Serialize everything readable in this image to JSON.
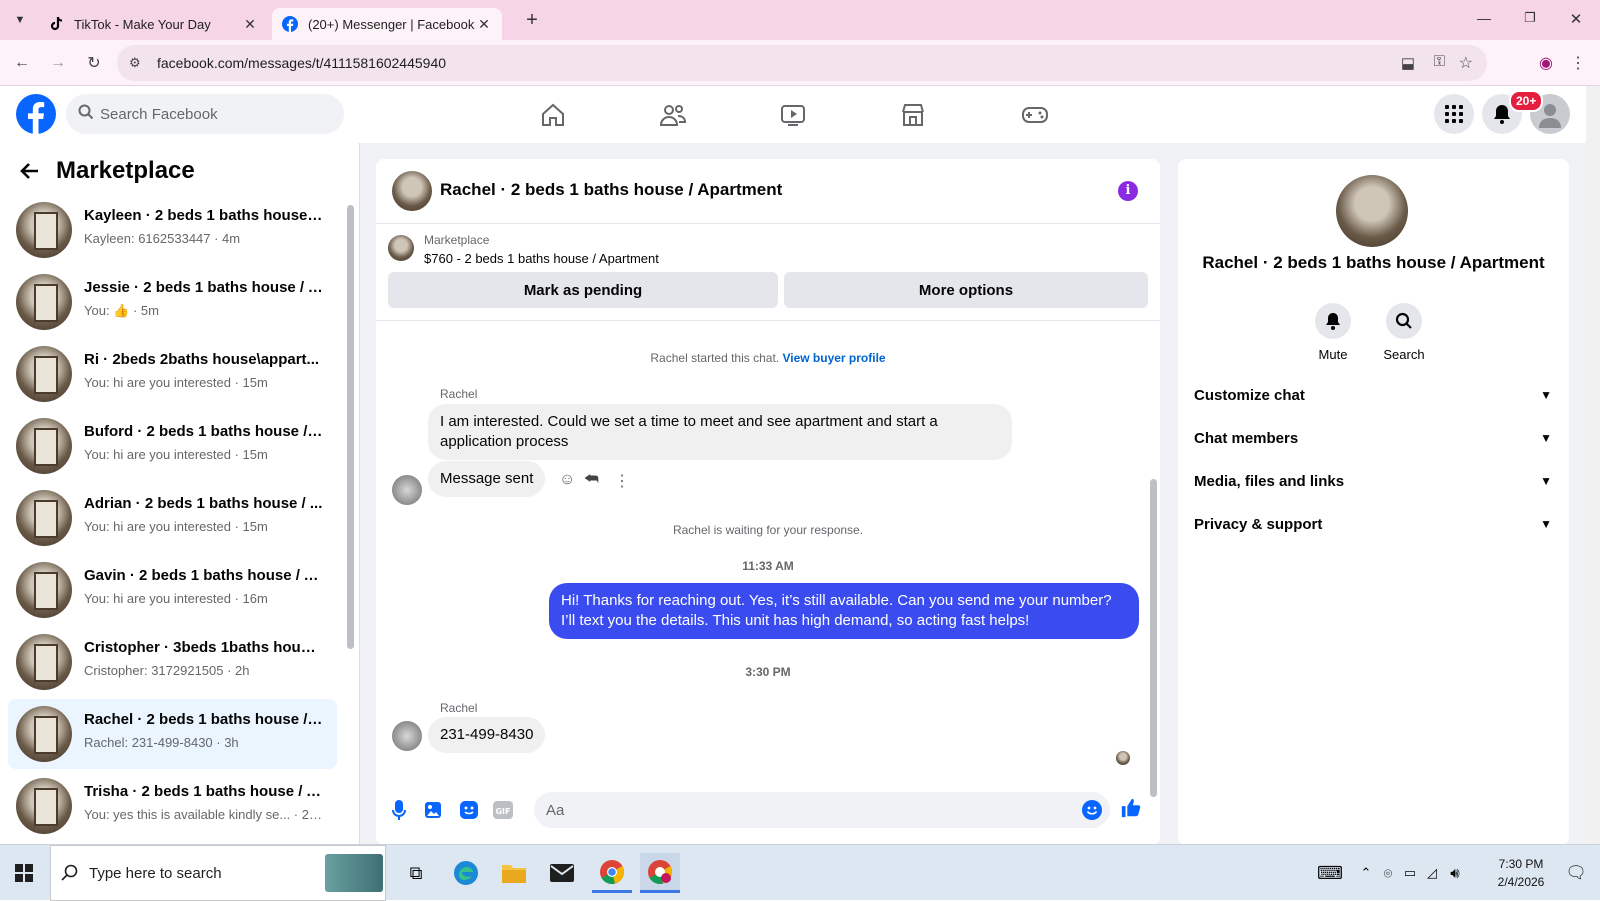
{
  "browser": {
    "tabs": [
      {
        "label": "TikTok - Make Your Day"
      },
      {
        "label": "(20+) Messenger | Facebook"
      }
    ],
    "url": "facebook.com/messages/t/4111581602445940"
  },
  "header": {
    "search_placeholder": "Search Facebook",
    "notification_badge": "20+"
  },
  "sidebar": {
    "title": "Marketplace",
    "conversations": [
      {
        "title": "Kayleen · 2 beds 1 baths house /...",
        "snippet": "Kayleen: 6162533447 · 4m"
      },
      {
        "title": "Jessie · 2 beds 1 baths house / A...",
        "snippet": "You: 👍 · 5m"
      },
      {
        "title": "Ri · 2beds 2baths house\\appart...",
        "snippet": "You: hi are you interested · 15m"
      },
      {
        "title": "Buford · 2 beds 1 baths house / ...",
        "snippet": "You: hi are you interested · 15m"
      },
      {
        "title": "Adrian · 2 beds 1 baths house / ...",
        "snippet": "You: hi are you interested · 15m"
      },
      {
        "title": "Gavin · 2 beds 1 baths house / A...",
        "snippet": "You: hi are you interested · 16m"
      },
      {
        "title": "Cristopher · 3beds 1baths house...",
        "snippet": "Cristopher: 3172921505 · 2h"
      },
      {
        "title": "Rachel · 2 beds 1 baths house / ...",
        "snippet": "Rachel: 231-499-8430 · 3h"
      },
      {
        "title": "Trisha · 2 beds 1 baths house / A...",
        "snippet": "You: yes this is available kindly se... · 26w"
      }
    ]
  },
  "chat": {
    "title": "Rachel · 2 beds 1 baths house / Apartment",
    "marketplace_label": "Marketplace",
    "listing": "$760 - 2 beds 1 baths house / Apartment",
    "mark_pending": "Mark as pending",
    "more_options": "More options",
    "started": "Rachel started this chat.",
    "view_profile": "View buyer profile",
    "sender_name": "Rachel",
    "msg1": "I am interested. Could we set a time to meet and see apartment and start a application process",
    "msg2": "Message sent",
    "waiting": "Rachel is waiting for your response.",
    "time1": "11:33 AM",
    "reply": "Hi! Thanks for reaching out. Yes, it’s still available. Can you send me your number? I’ll text you the details. This unit has high demand, so acting fast helps!",
    "time2": "3:30 PM",
    "msg3": "231-499-8430",
    "composer_placeholder": "Aa"
  },
  "details": {
    "title": "Rachel · 2 beds 1 baths house / Apartment",
    "mute": "Mute",
    "search": "Search",
    "sections": [
      "Customize chat",
      "Chat members",
      "Media, files and links",
      "Privacy & support"
    ]
  },
  "taskbar": {
    "search_placeholder": "Type here to search",
    "time": "7:30 PM",
    "date": "2/4/2026"
  },
  "colors": {
    "accent": "#3a4cf0",
    "facebook_blue": "#0866ff",
    "selected_row": "#ebf5ff"
  }
}
